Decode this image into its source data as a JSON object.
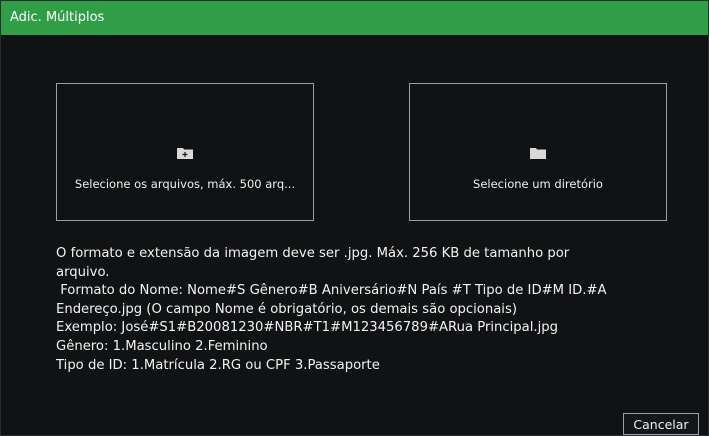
{
  "window": {
    "title": "Adic. Múltiplos"
  },
  "options": {
    "select_files": {
      "label": "Selecione os arquivos, máx. 500 arq...",
      "icon": "folder-add-icon"
    },
    "select_directory": {
      "label": "Selecione um diretório",
      "icon": "folder-icon"
    }
  },
  "info": {
    "lines": [
      "O formato e extensão da imagem deve ser .jpg. Máx. 256 KB de tamanho por",
      "arquivo.",
      " Formato do Nome: Nome#S Gênero#B Aniversário#N País #T Tipo de ID#M ID.#A",
      "Endereço.jpg (O campo Nome é obrigatório, os demais são opcionais)",
      "Exemplo: José#S1#B20081230#NBR#T1#M123456789#ARua Principal.jpg",
      "Gênero: 1.Masculino 2.Feminino",
      "Tipo de ID: 1.Matrícula 2.RG ou CPF 3.Passaporte"
    ]
  },
  "buttons": {
    "cancel_label": "Cancelar"
  },
  "colors": {
    "titlebar": "#2f9e46",
    "background": "#101214",
    "border": "#9aa0a6",
    "text": "#f0f0f0"
  }
}
